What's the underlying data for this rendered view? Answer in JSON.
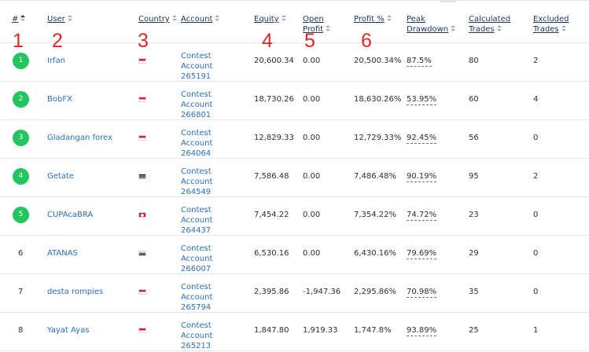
{
  "headers": {
    "rank": "#",
    "user": "User",
    "country": "Country",
    "account": "Account",
    "equity": "Equity",
    "open_profit_1": "Open",
    "open_profit_2": "Profit",
    "profit_pct": "Profit %",
    "peak_dd_1": "Peak",
    "peak_dd_2": "Drawdown",
    "calc_1": "Calculated",
    "calc_2": "Trades",
    "excl_1": "Excluded",
    "excl_2": "Trades"
  },
  "annotations": [
    "1",
    "2",
    "3",
    "4",
    "5",
    "6"
  ],
  "rows": [
    {
      "rank": "1",
      "user": "Irfan",
      "flag": "flag-indonesia-icon",
      "account_1": "Contest Account",
      "account_2": "265191",
      "equity": "20,600.34",
      "open_profit": "0.00",
      "profit_pct": "20,500.34%",
      "peak_dd": "87.5%",
      "calc": "80",
      "excl": "2",
      "badge": true
    },
    {
      "rank": "2",
      "user": "BobFX",
      "flag": "flag-indonesia-icon",
      "account_1": "Contest Account",
      "account_2": "266801",
      "equity": "18,730.26",
      "open_profit": "0.00",
      "profit_pct": "18,630.26%",
      "peak_dd": "53.95%",
      "calc": "60",
      "excl": "4",
      "badge": true
    },
    {
      "rank": "3",
      "user": "Gladangan forex",
      "flag": "flag-indonesia-icon",
      "account_1": "Contest Account",
      "account_2": "264064",
      "equity": "12,829.33",
      "open_profit": "0.00",
      "profit_pct": "12,729.33%",
      "peak_dd": "92.45%",
      "calc": "56",
      "excl": "0",
      "badge": true
    },
    {
      "rank": "4",
      "user": "Getate",
      "flag": "flag-kenya-icon",
      "account_1": "Contest Account",
      "account_2": "264549",
      "equity": "7,586.48",
      "open_profit": "0.00",
      "profit_pct": "7,486.48%",
      "peak_dd": "90.19%",
      "calc": "95",
      "excl": "2",
      "badge": true
    },
    {
      "rank": "5",
      "user": "CUPAcaBRA",
      "flag": "flag-switzerland-icon",
      "account_1": "Contest Account",
      "account_2": "264437",
      "equity": "7,454.22",
      "open_profit": "0.00",
      "profit_pct": "7,354.22%",
      "peak_dd": "74.72%",
      "calc": "23",
      "excl": "0",
      "badge": true
    },
    {
      "rank": "6",
      "user": "ATANAS",
      "flag": "flag-bulgaria-icon",
      "account_1": "Contest Account",
      "account_2": "266007",
      "equity": "6,530.16",
      "open_profit": "0.00",
      "profit_pct": "6,430.16%",
      "peak_dd": "79.69%",
      "calc": "29",
      "excl": "0",
      "badge": false
    },
    {
      "rank": "7",
      "user": "desta rompies",
      "flag": "flag-indonesia-icon",
      "account_1": "Contest Account",
      "account_2": "265794",
      "equity": "2,395.86",
      "open_profit": "-1,947.36",
      "profit_pct": "2,295.86%",
      "peak_dd": "70.98%",
      "calc": "35",
      "excl": "0",
      "badge": false
    },
    {
      "rank": "8",
      "user": "Yayat Ayas",
      "flag": "flag-indonesia-icon",
      "account_1": "Contest Account",
      "account_2": "265213",
      "equity": "1,847.80",
      "open_profit": "1,919.33",
      "profit_pct": "1,747.8%",
      "peak_dd": "93.89%",
      "calc": "25",
      "excl": "1",
      "badge": false
    }
  ],
  "colors": {
    "badge_green": "#22c55e",
    "link_blue": "#2a6ebb",
    "header_navy": "#1d3557",
    "annotation_red": "#e0262b"
  }
}
